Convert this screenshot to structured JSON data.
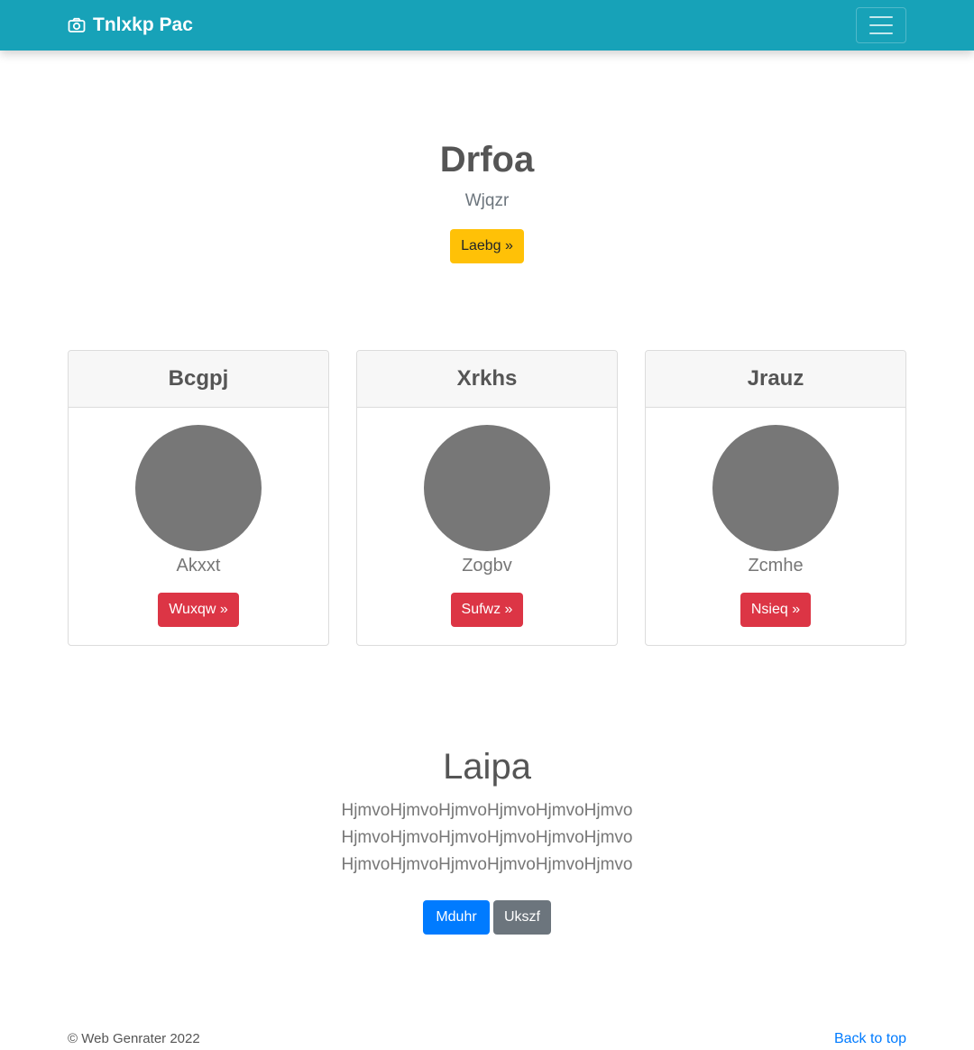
{
  "navbar": {
    "brand_icon": "camera-icon",
    "brand": "Tnlxkp Pac",
    "toggler_icon": "hamburger-menu-icon",
    "color": "#17a2b8"
  },
  "hero": {
    "title": "Drfoa",
    "subtitle": "Wjqzr",
    "button": "Laebg »"
  },
  "cards": [
    {
      "header": "Bcgpj",
      "text": "Akxxt",
      "button": "Wuxqw »"
    },
    {
      "header": "Xrkhs",
      "text": "Zogbv",
      "button": "Sufwz »"
    },
    {
      "header": "Jrauz",
      "text": "Zcmhe",
      "button": "Nsieq »"
    }
  ],
  "section": {
    "title": "Laipa",
    "lines": [
      "HjmvoHjmvoHjmvoHjmvoHjmvoHjmvo",
      "HjmvoHjmvoHjmvoHjmvoHjmvoHjmvo",
      "HjmvoHjmvoHjmvoHjmvoHjmvoHjmvo"
    ],
    "primary_button": "Mduhr",
    "secondary_button": "Ukszf"
  },
  "footer": {
    "copyright": "© Web Genrater 2022",
    "back_to_top": "Back to top"
  },
  "colors": {
    "warning": "#ffc107",
    "danger": "#dc3545",
    "primary": "#007bff",
    "secondary": "#6c757d"
  }
}
